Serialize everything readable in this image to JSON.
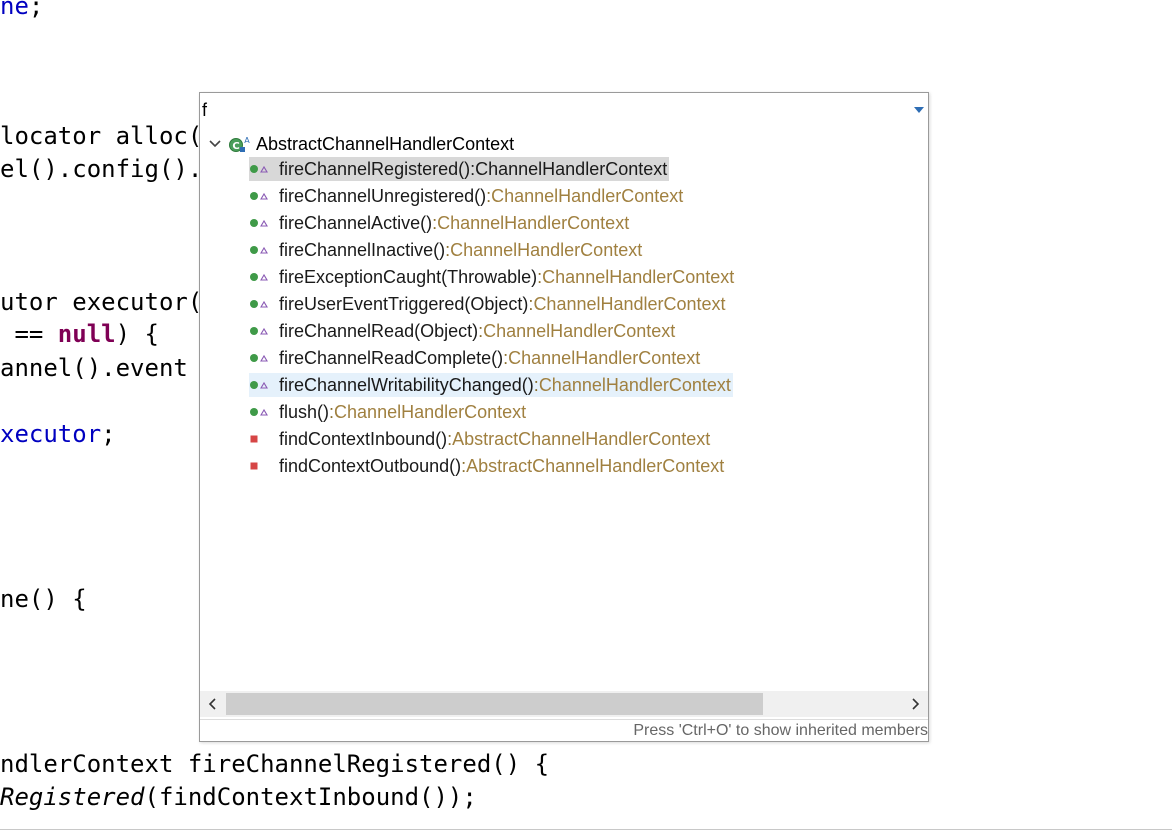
{
  "editor": {
    "lines": [
      {
        "parts": [
          {
            "t": "ne",
            "c": "fld"
          },
          {
            "t": ";"
          }
        ]
      },
      {
        "parts": [
          {
            "t": "locator alloc("
          }
        ]
      },
      {
        "parts": [
          {
            "t": "el().config()."
          }
        ]
      },
      {
        "parts": [
          {
            "t": "utor executor("
          }
        ]
      },
      {
        "parts": [
          {
            "t": " == "
          },
          {
            "t": "null",
            "c": "kw"
          },
          {
            "t": ") {"
          }
        ]
      },
      {
        "parts": [
          {
            "t": "annel().event"
          }
        ]
      },
      {
        "parts": [
          {
            "t": "xecutor",
            "c": "fld"
          },
          {
            "t": ";"
          }
        ]
      },
      {
        "parts": [
          {
            "t": "ne() {"
          }
        ]
      },
      {
        "parts": [
          {
            "t": "ndlerContext fireChannelRegistered() {"
          }
        ]
      },
      {
        "parts": [
          {
            "t": "Registered",
            "c": "it"
          },
          {
            "t": "(findContextInbound());"
          }
        ]
      }
    ]
  },
  "outline": {
    "filter_value": "f",
    "root_label": "AbstractChannelHandlerContext",
    "members": [
      {
        "name": "fireChannelRegistered()",
        "sep": " : ",
        "type": "ChannelHandlerContext",
        "vis": "public",
        "state": "selected"
      },
      {
        "name": "fireChannelUnregistered()",
        "sep": " : ",
        "type": "ChannelHandlerContext",
        "vis": "public",
        "state": ""
      },
      {
        "name": "fireChannelActive()",
        "sep": " : ",
        "type": "ChannelHandlerContext",
        "vis": "public",
        "state": ""
      },
      {
        "name": "fireChannelInactive()",
        "sep": " : ",
        "type": "ChannelHandlerContext",
        "vis": "public",
        "state": ""
      },
      {
        "name": "fireExceptionCaught(Throwable)",
        "sep": " : ",
        "type": "ChannelHandlerContext",
        "vis": "public",
        "state": ""
      },
      {
        "name": "fireUserEventTriggered(Object)",
        "sep": " : ",
        "type": "ChannelHandlerContext",
        "vis": "public",
        "state": ""
      },
      {
        "name": "fireChannelRead(Object)",
        "sep": " : ",
        "type": "ChannelHandlerContext",
        "vis": "public",
        "state": ""
      },
      {
        "name": "fireChannelReadComplete()",
        "sep": " : ",
        "type": "ChannelHandlerContext",
        "vis": "public",
        "state": ""
      },
      {
        "name": "fireChannelWritabilityChanged()",
        "sep": " : ",
        "type": "ChannelHandlerContext",
        "vis": "public",
        "state": "hover"
      },
      {
        "name": "flush()",
        "sep": " : ",
        "type": "ChannelHandlerContext",
        "vis": "public",
        "state": ""
      },
      {
        "name": "findContextInbound()",
        "sep": " : ",
        "type": "AbstractChannelHandlerContext",
        "vis": "private",
        "state": ""
      },
      {
        "name": "findContextOutbound()",
        "sep": " : ",
        "type": "AbstractChannelHandlerContext",
        "vis": "private",
        "state": ""
      }
    ],
    "status_text": "Press 'Ctrl+O' to show inherited members"
  },
  "colors": {
    "public_icon": "#3f9a48",
    "override_marker": "#8a5ab4",
    "private_icon": "#d64545",
    "selection": "#d8d8d8",
    "hover": "#e5f1fb",
    "type_text": "#a08040"
  }
}
